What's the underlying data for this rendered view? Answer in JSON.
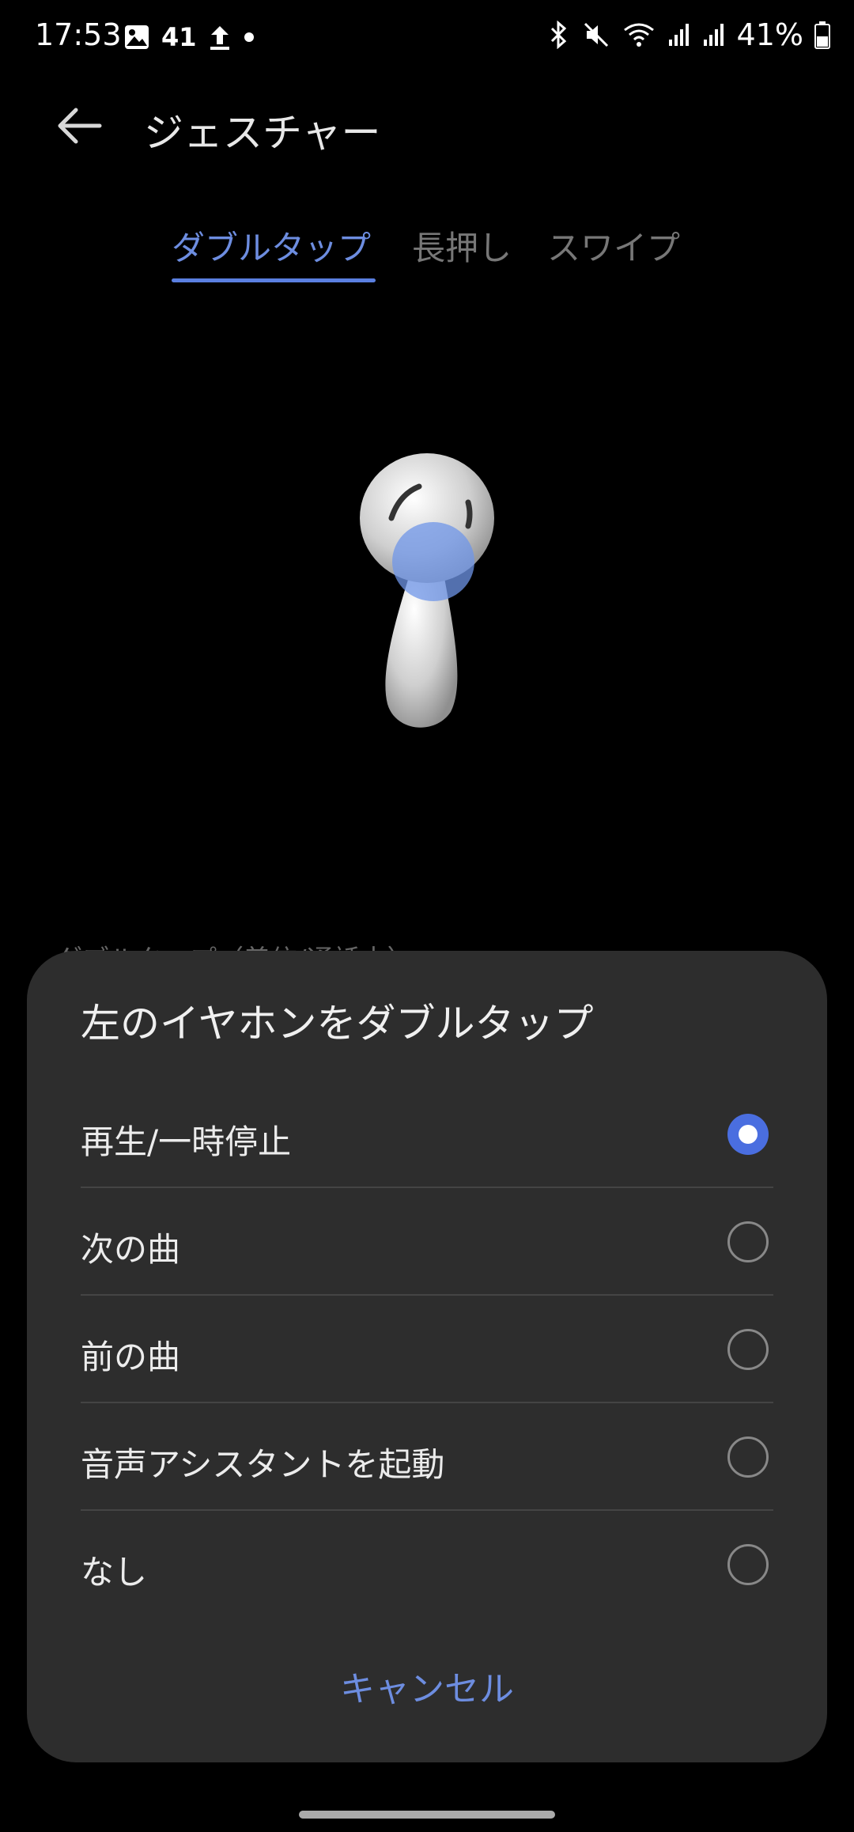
{
  "status_bar": {
    "time": "17:53",
    "notification_badge": "41",
    "battery": "41%",
    "icons_left": [
      "gallery-icon",
      "upload-icon",
      "dot-icon"
    ],
    "icons_right": [
      "bluetooth-icon",
      "mute-icon",
      "wifi-icon",
      "signal-icon",
      "signal-icon",
      "battery-icon"
    ]
  },
  "header": {
    "title": "ジェスチャー",
    "back_icon": "back-arrow-icon"
  },
  "tabs": [
    {
      "label": "ダブルタップ",
      "active": true
    },
    {
      "label": "長押し",
      "active": false
    },
    {
      "label": "スワイプ",
      "active": false
    }
  ],
  "background_section_label": "ダブルタップ（着信/通話中）",
  "dialog": {
    "title": "左のイヤホンをダブルタップ",
    "options": [
      {
        "label": "再生/一時停止",
        "selected": true
      },
      {
        "label": "次の曲",
        "selected": false
      },
      {
        "label": "前の曲",
        "selected": false
      },
      {
        "label": "音声アシスタントを起動",
        "selected": false
      },
      {
        "label": "なし",
        "selected": false
      }
    ],
    "cancel_label": "キャンセル"
  },
  "colors": {
    "accent": "#4a6ee0",
    "sheet_background": "#2d2d2d",
    "background": "#000000"
  }
}
